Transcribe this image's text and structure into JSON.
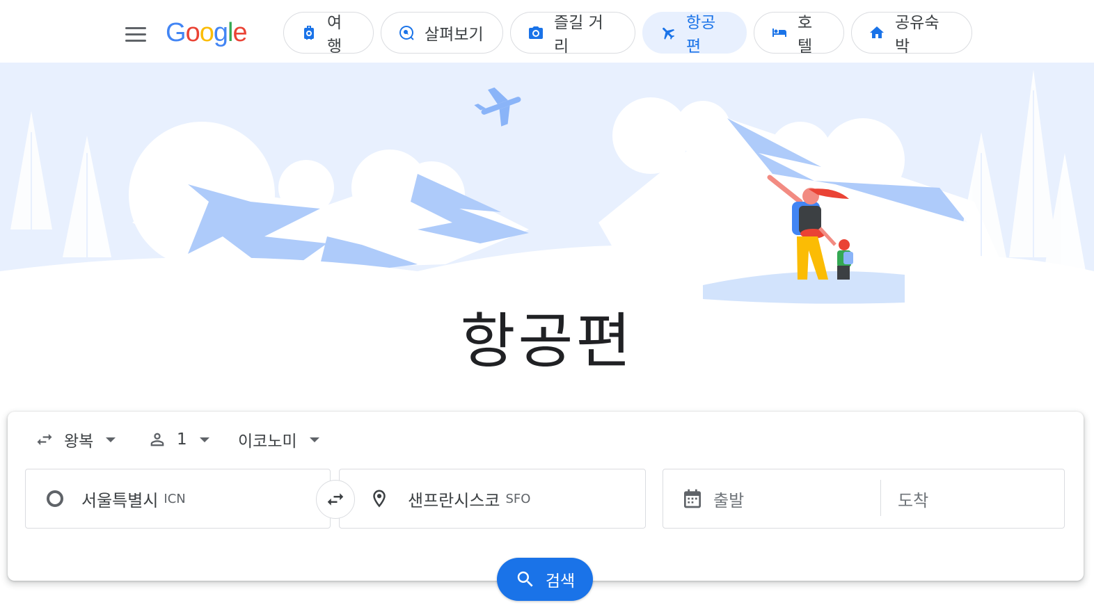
{
  "header": {
    "logo": [
      "G",
      "o",
      "o",
      "g",
      "l",
      "e"
    ],
    "logo_colors": [
      "#4285F4",
      "#EA4335",
      "#FBBC05",
      "#4285F4",
      "#34A853",
      "#EA4335"
    ],
    "tabs": [
      {
        "label": "여행",
        "icon": "luggage-icon"
      },
      {
        "label": "살펴보기",
        "icon": "explore-icon"
      },
      {
        "label": "즐길 거리",
        "icon": "camera-icon"
      },
      {
        "label": "항공편",
        "icon": "flight-icon",
        "active": true
      },
      {
        "label": "호텔",
        "icon": "bed-icon"
      },
      {
        "label": "공유숙박",
        "icon": "home-icon"
      }
    ]
  },
  "hero": {
    "title": "항공편"
  },
  "search": {
    "trip_type": "왕복",
    "passengers": "1",
    "cabin_class": "이코노미",
    "origin": {
      "city": "서울특별시",
      "code": "ICN"
    },
    "destination": {
      "city": "샌프란시스코",
      "code": "SFO"
    },
    "depart_placeholder": "출발",
    "return_placeholder": "도착",
    "search_label": "검색"
  },
  "colors": {
    "accent": "#1a73e8",
    "active_tab_bg": "#e8f0fe",
    "hero_bg": "#e8f0fe"
  }
}
